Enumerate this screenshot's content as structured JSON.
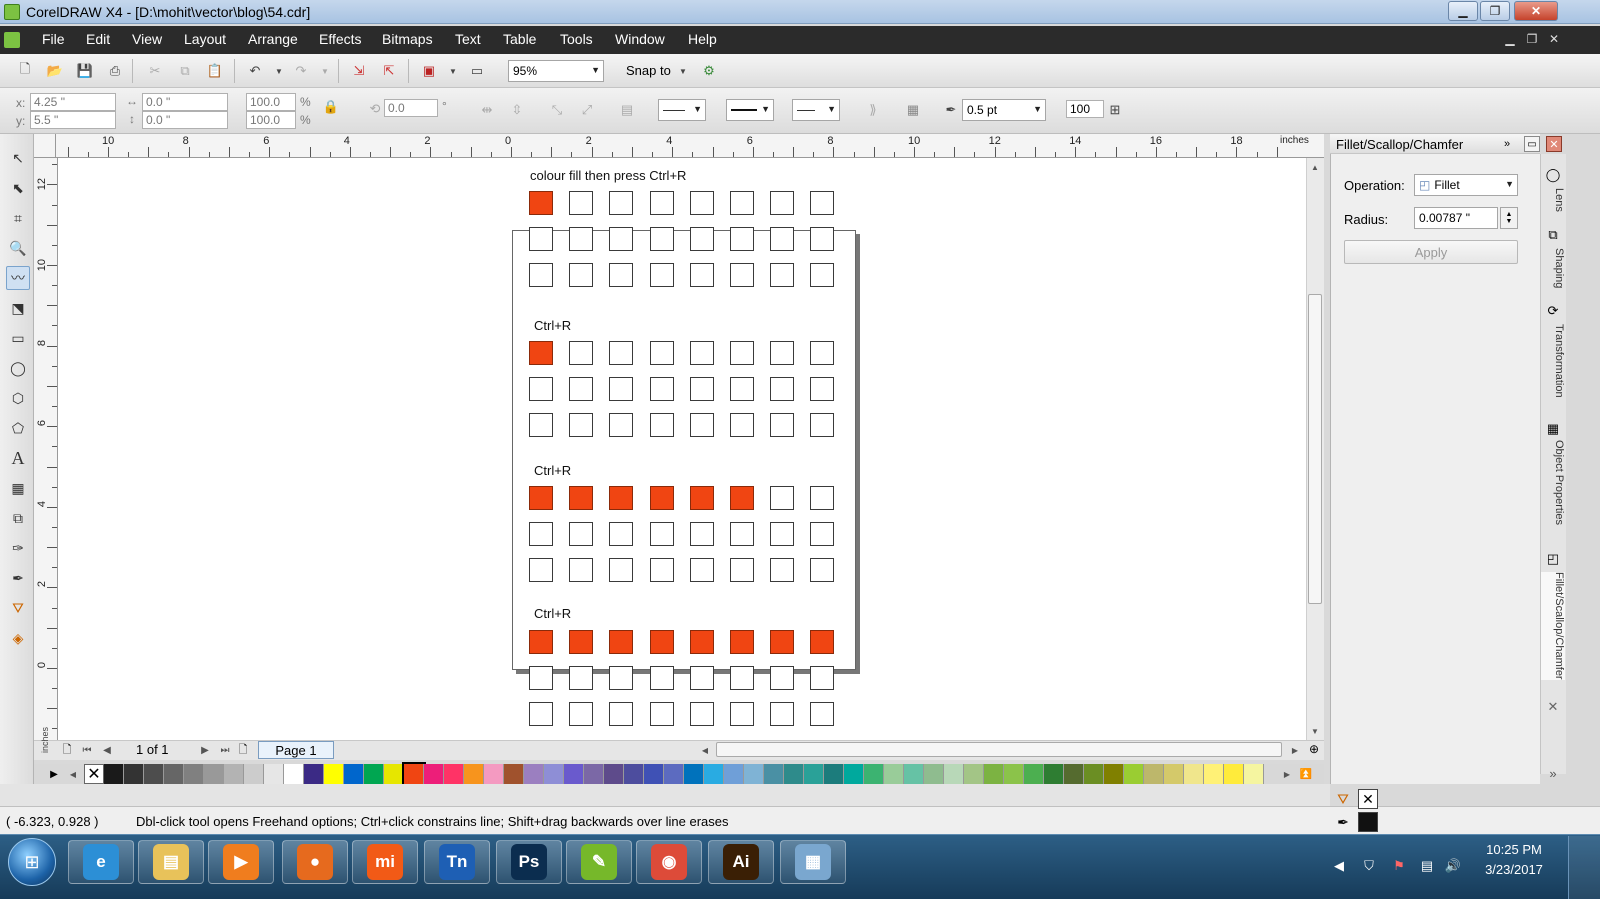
{
  "window": {
    "title": "CorelDRAW X4 - [D:\\mohit\\vector\\blog\\54.cdr]"
  },
  "menu": [
    "File",
    "Edit",
    "View",
    "Layout",
    "Arrange",
    "Effects",
    "Bitmaps",
    "Text",
    "Table",
    "Tools",
    "Window",
    "Help"
  ],
  "toolbar": {
    "zoom": "95%",
    "snap_label": "Snap to"
  },
  "propbar": {
    "x_label": "x:",
    "x": "4.25 \"",
    "y_label": "y:",
    "y": "5.5 \"",
    "w": "0.0 \"",
    "h": "0.0 \"",
    "scale_w": "100.0",
    "scale_h": "100.0",
    "pct": "%",
    "angle": "0.0",
    "deg": "°",
    "outline_width": "0.5 pt",
    "smoothing": "100"
  },
  "ruler": {
    "h_labels": [
      "10",
      "8",
      "6",
      "4",
      "2",
      "0",
      "2",
      "4",
      "6",
      "8",
      "10",
      "12",
      "14",
      "16",
      "18"
    ],
    "h_unit": "inches",
    "v_labels": [
      "12",
      "10",
      "8",
      "6",
      "4",
      "2",
      "0"
    ],
    "v_unit": "inches"
  },
  "canvas": {
    "labels": [
      "colour fill then press Ctrl+R",
      "Ctrl+R",
      "Ctrl+R",
      "Ctrl+R"
    ],
    "groups": [
      [
        [
          1,
          0,
          0,
          0,
          0,
          0,
          0,
          0
        ],
        [
          0,
          0,
          0,
          0,
          0,
          0,
          0,
          0
        ],
        [
          0,
          0,
          0,
          0,
          0,
          0,
          0,
          0
        ]
      ],
      [
        [
          1,
          0,
          0,
          0,
          0,
          0,
          0,
          0
        ],
        [
          0,
          0,
          0,
          0,
          0,
          0,
          0,
          0
        ],
        [
          0,
          0,
          0,
          0,
          0,
          0,
          0,
          0
        ]
      ],
      [
        [
          1,
          1,
          1,
          1,
          1,
          1,
          0,
          0
        ],
        [
          0,
          0,
          0,
          0,
          0,
          0,
          0,
          0
        ],
        [
          0,
          0,
          0,
          0,
          0,
          0,
          0,
          0
        ]
      ],
      [
        [
          1,
          1,
          1,
          1,
          1,
          1,
          1,
          1
        ],
        [
          0,
          0,
          0,
          0,
          0,
          0,
          0,
          0
        ],
        [
          0,
          0,
          0,
          0,
          0,
          0,
          0,
          0
        ]
      ]
    ],
    "fill_color": "#f04512"
  },
  "pagenav": {
    "counter": "1 of 1",
    "tab": "Page 1"
  },
  "palette": [
    "#1a1a1a",
    "#333333",
    "#4d4d4d",
    "#666666",
    "#808080",
    "#999999",
    "#b3b3b3",
    "#cccccc",
    "#e6e6e6",
    "#ffffff",
    "#3b2a85",
    "#ffff00",
    "#0066cc",
    "#00a651",
    "#e6e600",
    "#f04512",
    "#ed1e79",
    "#ff3366",
    "#f7941d",
    "#f49ac1",
    "#a0522d",
    "#9b7fc0",
    "#8e8ed6",
    "#6a5acd",
    "#7b68a6",
    "#5e4b8b",
    "#4d4d9e",
    "#3f51b5",
    "#5c6bc0",
    "#0072bc",
    "#29abe2",
    "#6f9fd8",
    "#7fb3d5",
    "#4a90a4",
    "#2e8b8b",
    "#2aa198",
    "#1c7c7c",
    "#00a99d",
    "#3cb371",
    "#99cc99",
    "#66c2a5",
    "#8fbc8f",
    "#b8d8b8",
    "#a3c586",
    "#7cb342",
    "#8bc34a",
    "#4caf50",
    "#2e7d32",
    "#556b2f",
    "#6b8e23",
    "#808000",
    "#9acd32",
    "#bdb76b",
    "#d4c96a",
    "#f0e68c",
    "#fff176",
    "#ffeb3b",
    "#f5f5a0",
    "#c8b88a",
    "#d2b48c",
    "#8b7355"
  ],
  "status": {
    "coords": "( -6.323, 0.928 )",
    "hint": "Dbl-click tool opens Freehand options; Ctrl+click constrains line; Shift+drag backwards over line erases"
  },
  "docker": {
    "title": "Fillet/Scallop/Chamfer",
    "operation_label": "Operation:",
    "operation_value": "Fillet",
    "radius_label": "Radius:",
    "radius_value": "0.00787 \"",
    "apply": "Apply",
    "tabs": [
      "Lens",
      "Shaping",
      "Transformation",
      "Object Properties",
      "Fillet/Scallop/Chamfer"
    ]
  },
  "taskbar": {
    "apps": [
      {
        "name": "internet-explorer",
        "glyph": "e",
        "color": "#2c8fd6"
      },
      {
        "name": "file-explorer",
        "glyph": "▤",
        "color": "#e8c25a"
      },
      {
        "name": "media-player",
        "glyph": "▶",
        "color": "#f07d1e"
      },
      {
        "name": "firefox",
        "glyph": "●",
        "color": "#e66a1e"
      },
      {
        "name": "mi",
        "glyph": "mi",
        "color": "#f25a16"
      },
      {
        "name": "tn-app",
        "glyph": "Tn",
        "color": "#1e5fb4"
      },
      {
        "name": "photoshop",
        "glyph": "Ps",
        "color": "#0b2d4f"
      },
      {
        "name": "coreldraw",
        "glyph": "✎",
        "color": "#76b82a"
      },
      {
        "name": "chrome",
        "glyph": "◉",
        "color": "#dd4b39"
      },
      {
        "name": "illustrator",
        "glyph": "Ai",
        "color": "#3a1f05"
      },
      {
        "name": "calculator",
        "glyph": "▦",
        "color": "#7aa7cf"
      }
    ],
    "time": "10:25 PM",
    "date": "3/23/2017"
  }
}
